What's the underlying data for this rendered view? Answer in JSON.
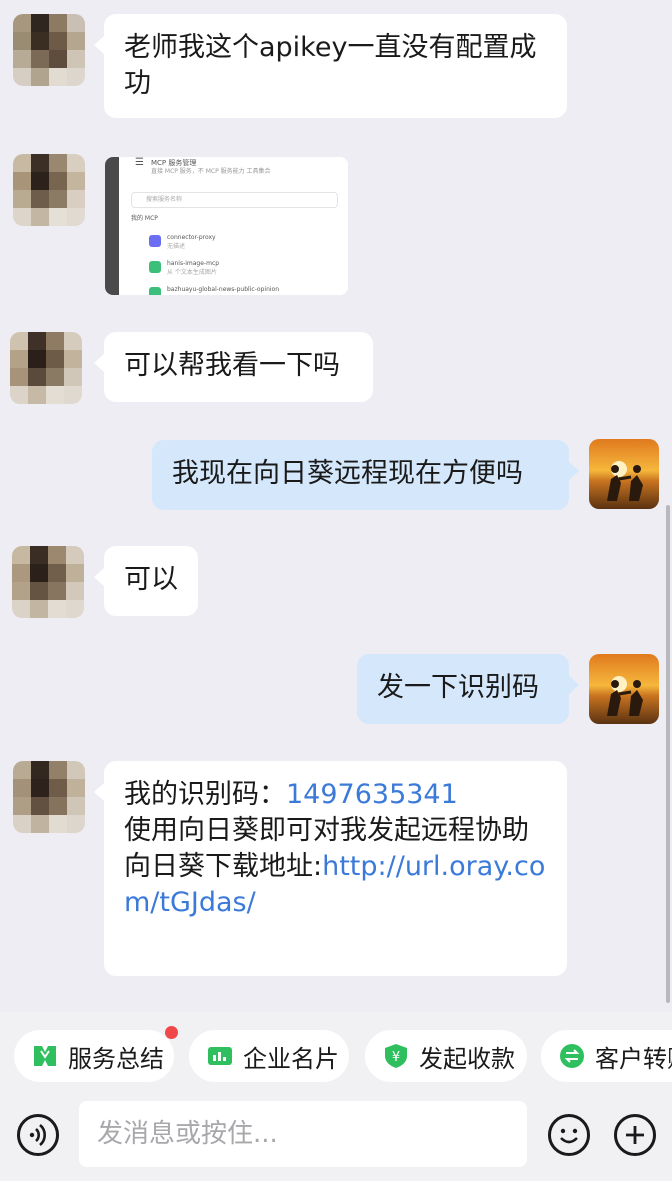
{
  "messages": {
    "m1": "老师我这个apikey一直没有配置成功",
    "m3": "可以帮我看一下吗",
    "m4": "我现在向日葵远程现在方便吗",
    "m5": "可以",
    "m6": "发一下识别码",
    "m7": {
      "line1_label": "我的识别码：",
      "line1_code": "1497635341",
      "line2": "使用向日葵即可对我发起远程协助",
      "line3_label": "向日葵下载地址:",
      "line3_link": "http://url.oray.com/tGJdas/"
    }
  },
  "screenshot": {
    "title": "MCP 服务管理",
    "subtitle": "直接 MCP 服务，不 MCP 服务能力 工具集合",
    "search_placeholder": "搜索服务名称",
    "section": "我的 MCP",
    "items": [
      {
        "name": "connector-proxy",
        "desc": "无描述",
        "color": "#6b6ef0"
      },
      {
        "name": "hanis-image-mcp",
        "desc": "从 个文本生成图片",
        "color": "#3bbf7a"
      },
      {
        "name": "bazhuayu-global-news-public-opinion",
        "desc": "",
        "color": "#3bbf7a"
      }
    ]
  },
  "quick_actions": [
    {
      "label": "服务总结",
      "icon": "service-summary-icon",
      "color": "#2fbf5e"
    },
    {
      "label": "企业名片",
      "icon": "business-card-icon",
      "color": "#2fbf5e"
    },
    {
      "label": "发起收款",
      "icon": "payment-icon",
      "color": "#2fbf5e"
    },
    {
      "label": "客户转赠",
      "icon": "transfer-icon",
      "color": "#2fbf5e"
    }
  ],
  "composer": {
    "placeholder": "发消息或按住..."
  },
  "colors": {
    "background": "#ededf3",
    "self_bubble": "#d4e7fb",
    "other_bubble": "#ffffff",
    "link": "#3b7ad8",
    "badge": "#f04848"
  }
}
